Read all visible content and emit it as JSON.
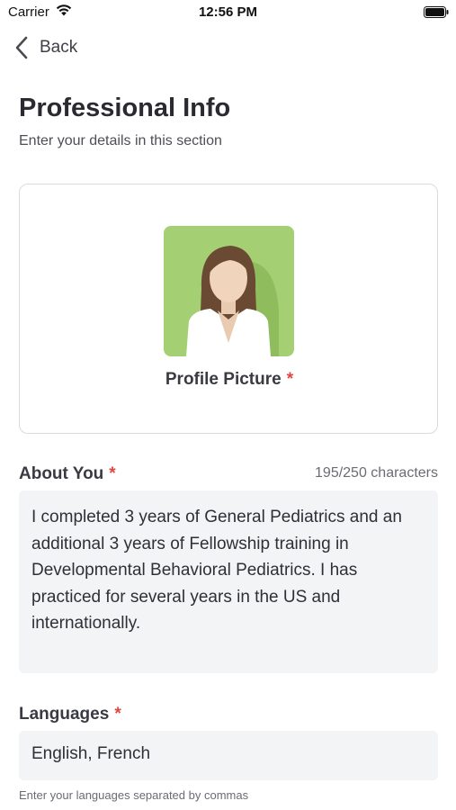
{
  "status_bar": {
    "carrier": "Carrier",
    "time": "12:56 PM"
  },
  "nav": {
    "back_label": "Back"
  },
  "header": {
    "title": "Professional Info",
    "subtitle": "Enter your details in this section"
  },
  "profile": {
    "label": "Profile Picture",
    "required_mark": "*"
  },
  "about": {
    "label": "About You",
    "required_mark": "*",
    "char_count": "195/250 characters",
    "value": "I completed 3 years of General Pediatrics and an additional 3 years of Fellowship training in Developmental Behavioral Pediatrics. I has practiced for several years in the US and internationally."
  },
  "languages": {
    "label": "Languages",
    "required_mark": "*",
    "value": "English, French",
    "helper": "Enter your languages separated by commas"
  },
  "colors": {
    "avatar_bg": "#a5cf73",
    "required": "#e0463f",
    "field_bg": "#f3f4f6"
  }
}
